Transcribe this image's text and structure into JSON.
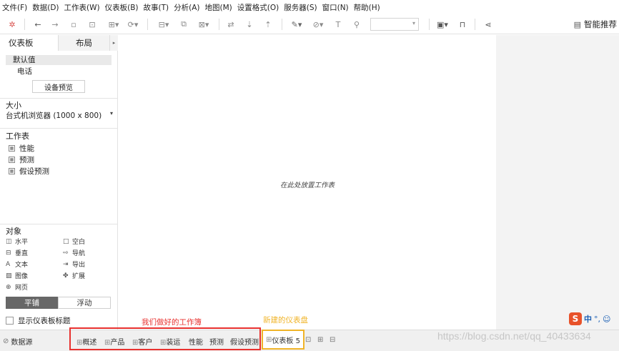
{
  "menu": [
    "文件(F)",
    "数据(D)",
    "工作表(W)",
    "仪表板(B)",
    "故事(T)",
    "分析(A)",
    "地图(M)",
    "设置格式(O)",
    "服务器(S)",
    "窗口(N)",
    "帮助(H)"
  ],
  "toolbar": {
    "smart_recommend": "智能推荐"
  },
  "left_panel": {
    "tab_dashboard": "仪表板",
    "tab_layout": "布局",
    "device_default": "默认值",
    "device_phone": "电话",
    "device_preview_button": "设备预览",
    "size_heading": "大小",
    "size_value": "台式机浏览器 (1000 x 800)",
    "worksheets_heading": "工作表",
    "worksheets": [
      "性能",
      "预测",
      "假设预测"
    ],
    "objects_heading": "对象",
    "objects": [
      {
        "icon": "horizontal-icon",
        "label": "水平"
      },
      {
        "icon": "blank-icon",
        "label": "空白"
      },
      {
        "icon": "vertical-icon",
        "label": "垂直"
      },
      {
        "icon": "navigation-icon",
        "label": "导航"
      },
      {
        "icon": "text-icon",
        "label": "文本"
      },
      {
        "icon": "export-icon",
        "label": "导出"
      },
      {
        "icon": "image-icon",
        "label": "图像"
      },
      {
        "icon": "extension-icon",
        "label": "扩展"
      },
      {
        "icon": "webpage-icon",
        "label": "网页"
      }
    ],
    "tiled": "平铺",
    "floating": "浮动",
    "show_title": "显示仪表板标题"
  },
  "canvas": {
    "placeholder": "在此处放置工作表"
  },
  "bottom": {
    "datasource": "数据源",
    "sheets": [
      "概述",
      "产品",
      "客户",
      "装运",
      "性能",
      "预测",
      "假设预测"
    ],
    "active_sheet": "仪表板 5"
  },
  "annotations": {
    "red_label": "我们做好的工作簿",
    "orange_label": "新建的仪表盘",
    "red_color": "#e8312f",
    "orange_color": "#f0b429"
  },
  "watermark": "https://blog.csdn.net/qq_40433634",
  "ime": {
    "main": "中",
    "dot": "°,",
    "smile": "☺"
  }
}
